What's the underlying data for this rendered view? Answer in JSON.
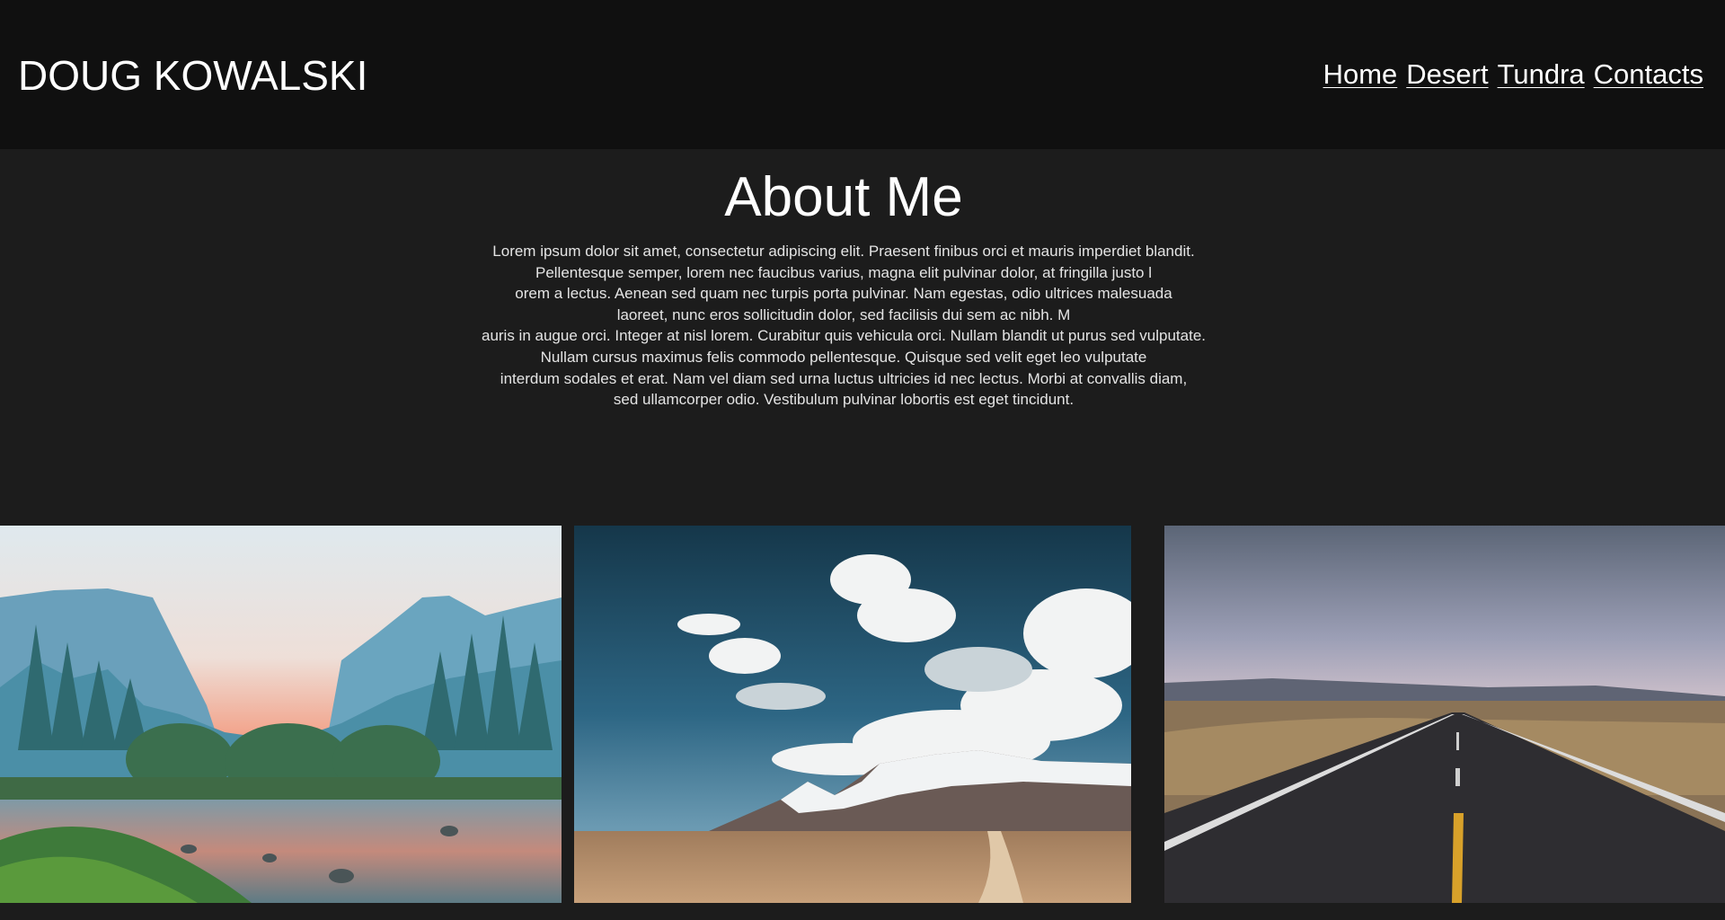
{
  "header": {
    "title": "DOUG KOWALSKI",
    "nav": [
      "Home",
      "Desert",
      "Tundra",
      "Contacts"
    ]
  },
  "about": {
    "heading": "About Me",
    "lines": [
      "Lorem ipsum dolor sit amet, consectetur adipiscing elit. Praesent finibus orci et mauris imperdiet blandit.",
      "Pellentesque semper, lorem nec faucibus varius, magna elit pulvinar dolor, at fringilla justo l",
      "orem a lectus. Aenean sed quam nec turpis porta pulvinar. Nam egestas, odio ultrices malesuada",
      "laoreet, nunc eros sollicitudin dolor, sed facilisis dui sem ac nibh. M",
      "auris in augue orci. Integer at nisl lorem. Curabitur quis vehicula orci. Nullam blandit ut purus sed vulputate.",
      "Nullam cursus maximus felis commodo pellentesque. Quisque sed velit eget leo vulputate",
      "interdum sodales et erat. Nam vel diam sed urna luctus ultricies id nec lectus. Morbi at convallis diam,",
      "sed ullamcorper odio. Vestibulum pulvinar lobortis est eget tincidunt."
    ]
  },
  "colors": {
    "header_bg": "#101010",
    "page_bg": "#1c1c1c",
    "text": "#ffffff"
  }
}
